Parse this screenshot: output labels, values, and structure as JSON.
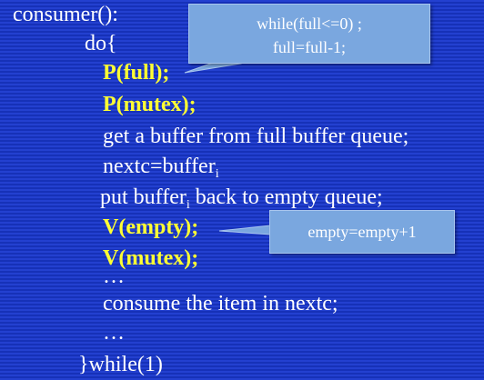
{
  "code": {
    "l1": "consumer():",
    "l2": "do{",
    "l3": "P(full);",
    "l4": "P(mutex);",
    "l5": "get a buffer from full buffer queue;",
    "l6_main": "nextc=buffer",
    "l6_sub": "i",
    "l7_a": "put buffer",
    "l7_sub": "i",
    "l7_b": " back to empty queue;",
    "l8": "V(empty);",
    "l9": "V(mutex);",
    "l10": "…",
    "l11": "consume the item in nextc;",
    "l12": "…",
    "l13": "}while(1)"
  },
  "callouts": {
    "full_line1": "while(full<=0) ;",
    "full_line2": "full=full-1;",
    "empty": "empty=empty+1"
  },
  "colors": {
    "background": "#1d35c4",
    "highlight": "#ffff33",
    "callout": "#7aa7df"
  }
}
